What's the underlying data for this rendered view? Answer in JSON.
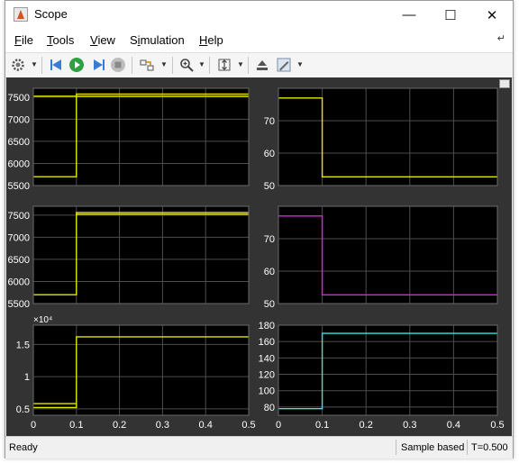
{
  "window": {
    "title": "Scope",
    "controls": {
      "minimize": "—",
      "maximize": "☐",
      "close": "✕"
    }
  },
  "menu": [
    {
      "label": "File",
      "key": "F",
      "rest": "ile"
    },
    {
      "label": "Tools",
      "key": "T",
      "rest": "ools"
    },
    {
      "label": "View",
      "key": "V",
      "rest": "iew"
    },
    {
      "label": "Simulation",
      "key": "i",
      "pre": "S",
      "rest": "mulation"
    },
    {
      "label": "Help",
      "key": "H",
      "rest": "elp"
    }
  ],
  "toolbar_icons": [
    "settings-gear-icon",
    "step-back-icon",
    "run-icon",
    "step-forward-icon",
    "stop-icon",
    "highlight-block-icon",
    "zoom-in-icon",
    "autoscale-icon",
    "restore-layout-icon",
    "style-icon"
  ],
  "status": {
    "left": "Ready",
    "mid": "Sample based",
    "right": "T=0.500"
  },
  "colors": {
    "plot_bg": "#000000",
    "frame_bg": "#333333",
    "grid": "#4d4d4d",
    "axis_text": "#ffffff",
    "yellow": "#e6e600",
    "magenta": "#e61ee6",
    "cyan": "#33e6e6"
  },
  "chart_data": [
    {
      "type": "line",
      "id": "r1c1",
      "xlim": [
        0,
        0.5
      ],
      "ylim": [
        5500,
        7700
      ],
      "yticks": [
        5500,
        6000,
        6500,
        7000,
        7500
      ],
      "xticks": [
        0,
        0.1,
        0.2,
        0.3,
        0.4,
        0.5
      ],
      "show_xtick_labels": false,
      "series": [
        {
          "color": "#e6e600",
          "x": [
            0,
            0.1,
            0.1,
            0.5
          ],
          "y": [
            5700,
            5700,
            7570,
            7570
          ]
        },
        {
          "color": "#e6e600",
          "x": [
            0,
            0.5
          ],
          "y": [
            7520,
            7520
          ],
          "x_start": 0.1
        }
      ]
    },
    {
      "type": "line",
      "id": "r1c2",
      "xlim": [
        0,
        0.5
      ],
      "ylim": [
        50,
        80
      ],
      "yticks": [
        50,
        60,
        70
      ],
      "xticks": [
        0,
        0.1,
        0.2,
        0.3,
        0.4,
        0.5
      ],
      "show_xtick_labels": false,
      "series": [
        {
          "color": "#e6e600",
          "x": [
            0,
            0.1,
            0.1,
            0.5
          ],
          "y": [
            77,
            77,
            52.7,
            52.7
          ]
        }
      ]
    },
    {
      "type": "line",
      "id": "r2c1",
      "xlim": [
        0,
        0.5
      ],
      "ylim": [
        5500,
        7700
      ],
      "yticks": [
        5500,
        6000,
        6500,
        7000,
        7500
      ],
      "xticks": [
        0,
        0.1,
        0.2,
        0.3,
        0.4,
        0.5
      ],
      "show_xtick_labels": false,
      "series": [
        {
          "color": "#e6e600",
          "x": [
            0,
            0.1,
            0.1,
            0.5
          ],
          "y": [
            5700,
            5700,
            7560,
            7560
          ]
        },
        {
          "color": "#e6e600",
          "x": [
            0.1,
            0.5
          ],
          "y": [
            7520,
            7520
          ]
        }
      ]
    },
    {
      "type": "line",
      "id": "r2c2",
      "xlim": [
        0,
        0.5
      ],
      "ylim": [
        50,
        80
      ],
      "yticks": [
        50,
        60,
        70
      ],
      "xticks": [
        0,
        0.1,
        0.2,
        0.3,
        0.4,
        0.5
      ],
      "show_xtick_labels": false,
      "series": [
        {
          "color": "#e61ee6",
          "x": [
            0,
            0.1,
            0.1,
            0.5
          ],
          "y": [
            77,
            77,
            52.7,
            52.7
          ]
        }
      ]
    },
    {
      "type": "line",
      "id": "r3c1",
      "xlim": [
        0,
        0.5
      ],
      "ylim": [
        0.4,
        1.8
      ],
      "yticks": [
        0.5,
        1,
        1.5
      ],
      "xticks": [
        0,
        0.1,
        0.2,
        0.3,
        0.4,
        0.5
      ],
      "exponent_label": "×10⁴",
      "show_xtick_labels": true,
      "series": [
        {
          "color": "#e6e600",
          "x": [
            0,
            0.1,
            0.1,
            0.5
          ],
          "y": [
            0.52,
            0.52,
            1.62,
            1.62
          ]
        },
        {
          "color": "#e6e600",
          "x": [
            0,
            0.1
          ],
          "y": [
            0.58,
            0.58
          ]
        }
      ]
    },
    {
      "type": "line",
      "id": "r3c2",
      "xlim": [
        0,
        0.5
      ],
      "ylim": [
        70,
        180
      ],
      "yticks": [
        80,
        100,
        120,
        140,
        160,
        180
      ],
      "xticks": [
        0,
        0.1,
        0.2,
        0.3,
        0.4,
        0.5
      ],
      "show_xtick_labels": true,
      "series": [
        {
          "color": "#33e6e6",
          "x": [
            0,
            0.1,
            0.1,
            0.5
          ],
          "y": [
            78,
            78,
            170,
            170
          ]
        }
      ]
    }
  ]
}
